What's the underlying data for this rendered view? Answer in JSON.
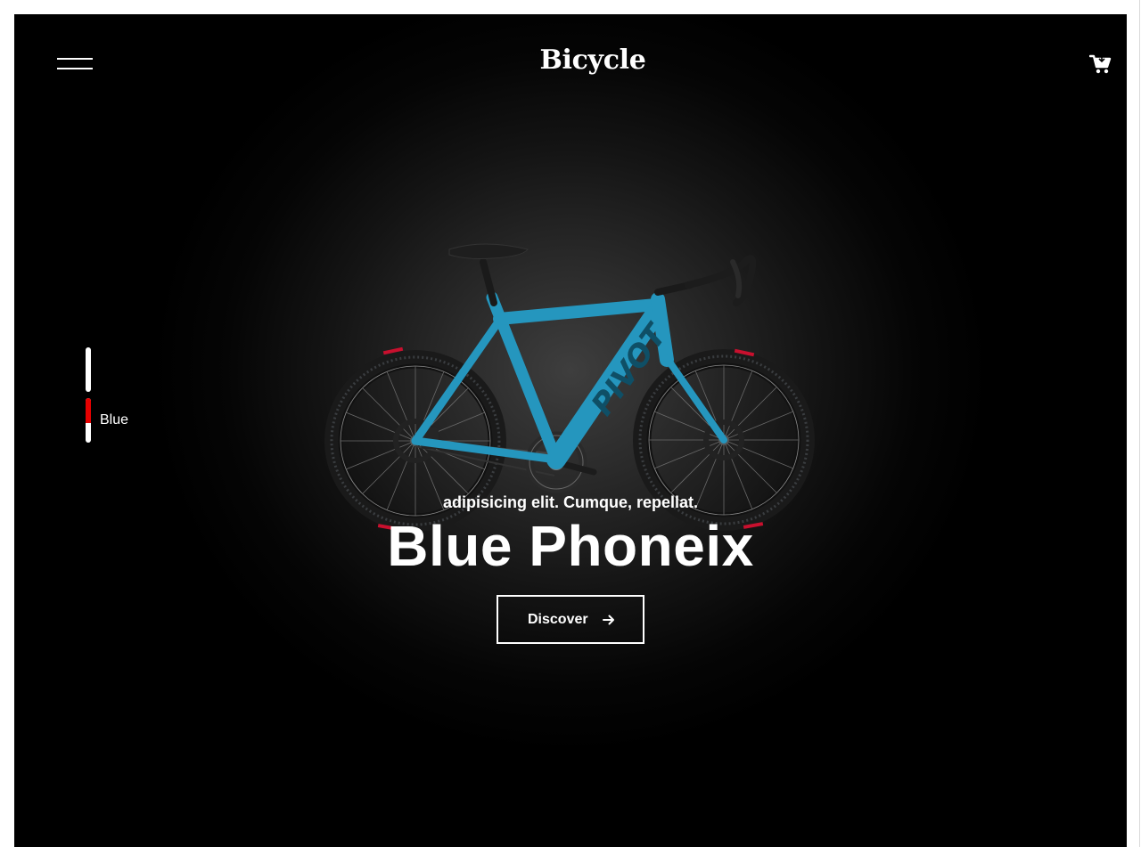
{
  "header": {
    "brand": "Bicycle"
  },
  "slider": {
    "active_label": "Blue",
    "slides": [
      {
        "progress": 0
      },
      {
        "progress": 0.55
      }
    ]
  },
  "hero": {
    "subtitle": "adipisicing elit. Cumque, repellat.",
    "title": "Blue Phoneix",
    "cta_label": "Discover"
  },
  "icons": {
    "menu": "hamburger-menu-icon",
    "cart": "cart-icon",
    "cta_arrow": "arrow-right-icon"
  },
  "colors": {
    "background": "#000000",
    "text": "#ffffff",
    "accent": "#e60000",
    "bike_frame": "#2596be"
  }
}
